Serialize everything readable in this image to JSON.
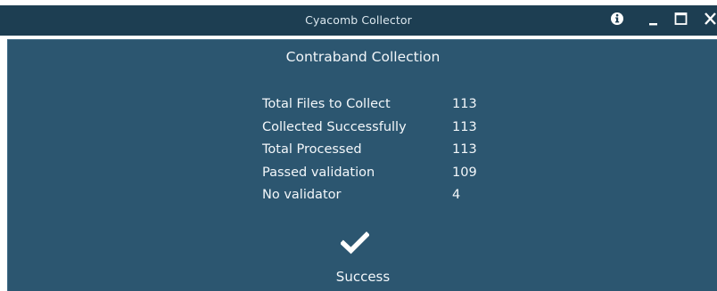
{
  "window": {
    "title": "Cyacomb Collector",
    "controls": {
      "info_icon": "info-icon",
      "minimize_icon": "minimize-icon",
      "maximize_icon": "maximize-icon",
      "close_icon": "close-icon"
    }
  },
  "panel": {
    "title": "Contraband Collection",
    "stats": [
      {
        "label": "Total Files to Collect",
        "value": "113"
      },
      {
        "label": "Collected Successfully",
        "value": "113"
      },
      {
        "label": "Total Processed",
        "value": "113"
      },
      {
        "label": "Passed validation",
        "value": "109"
      },
      {
        "label": "No validator",
        "value": "4"
      }
    ],
    "status": {
      "icon": "checkmark-icon",
      "text": "Success"
    }
  },
  "colors": {
    "titlebar": "#1d3e52",
    "panel": "#2c5670",
    "text": "#f3f7fa"
  }
}
